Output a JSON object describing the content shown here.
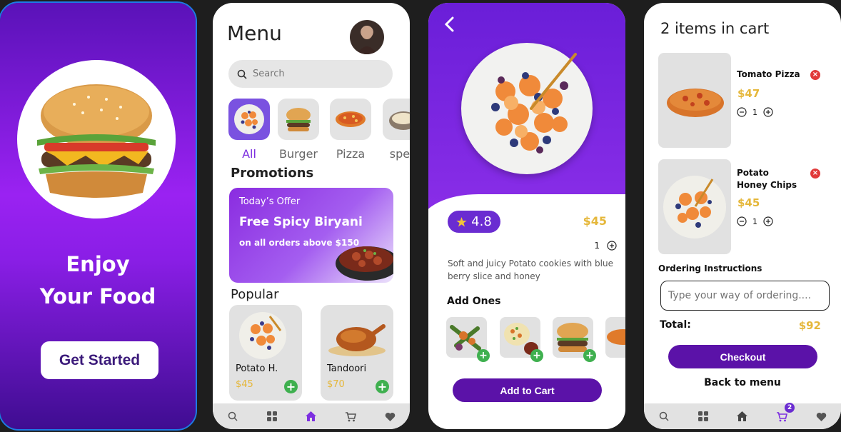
{
  "splash": {
    "title_line1": "Enjoy",
    "title_line2": "Your Food",
    "button": "Get Started"
  },
  "menu": {
    "title": "Menu",
    "search_placeholder": "Search",
    "categories": [
      {
        "label": "All",
        "active": true
      },
      {
        "label": "Burger",
        "active": false
      },
      {
        "label": "Pizza",
        "active": false
      },
      {
        "label": "speg",
        "active": false
      }
    ],
    "promotions_title": "Promotions",
    "promo": {
      "tag": "Today’s Offer",
      "headline": "Free Spicy Biryani",
      "sub": "on all orders above $150"
    },
    "popular_title": "Popular",
    "popular": [
      {
        "name": "Potato H.",
        "price": "$45"
      },
      {
        "name": "Tandoori",
        "price": "$70"
      }
    ]
  },
  "detail": {
    "rating": "4.8",
    "price": "$45",
    "quantity": "1",
    "description": "Soft and juicy Potato cookies with blue berry slice and honey",
    "addons_title": "Add Ones",
    "add_to_cart": "Add to Cart"
  },
  "cart": {
    "title": "2 items in cart",
    "items": [
      {
        "name": "Tomato Pizza",
        "price": "$47",
        "qty": "1"
      },
      {
        "name": "Potato Honey Chips",
        "price": "$45",
        "qty": "1"
      }
    ],
    "instructions_label": "Ordering Instructions",
    "instructions_placeholder": "Type your way of ordering....",
    "total_label": "Total:",
    "total_value": "$92",
    "checkout": "Checkout",
    "back": "Back to menu",
    "cart_badge": "2"
  },
  "colors": {
    "primary": "#5b12a8",
    "accent_purple": "#7d2fe0",
    "price_gold": "#e5b73a",
    "add_green": "#3fb04f",
    "remove_red": "#e13a3a"
  },
  "icons": [
    "search-icon",
    "grid-icon",
    "home-icon",
    "cart-icon",
    "heart-icon",
    "back-chevron-icon",
    "star-icon",
    "plus-icon",
    "minus-icon",
    "close-icon"
  ]
}
